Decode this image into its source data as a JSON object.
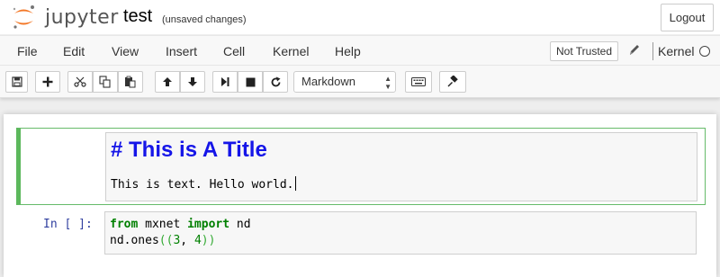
{
  "header": {
    "logo_text": "jupyter",
    "notebook_name": "test",
    "save_status": "(unsaved changes)",
    "logout_label": "Logout"
  },
  "menubar": {
    "items": [
      "File",
      "Edit",
      "View",
      "Insert",
      "Cell",
      "Kernel",
      "Help"
    ],
    "trust_label": "Not Trusted",
    "kernel_label": "Kernel"
  },
  "toolbar": {
    "buttons": [
      "save-icon",
      "add-cell-icon",
      "cut-icon",
      "copy-icon",
      "paste-icon",
      "move-up-icon",
      "move-down-icon",
      "run-icon",
      "stop-icon",
      "restart-icon",
      "keyboard-icon",
      "command-palette-icon"
    ],
    "cell_type": "Markdown"
  },
  "cells": {
    "markdown": {
      "title_line": "# This is A Title",
      "text_line": "This is text. Hello world."
    },
    "code": {
      "prompt": "In [ ]:",
      "line1": {
        "kw1": "from",
        "mod": " mxnet ",
        "kw2": "import",
        "name": " nd"
      },
      "line2": {
        "pre": "nd.ones",
        "open": "((",
        "n1": "3",
        "comma": ", ",
        "n2": "4",
        "close": "))"
      }
    }
  },
  "colors": {
    "accent_green": "#5cb85c",
    "heading_blue": "#1515e8",
    "prompt_blue": "#303f9f",
    "jupyter_orange": "#f37726"
  }
}
